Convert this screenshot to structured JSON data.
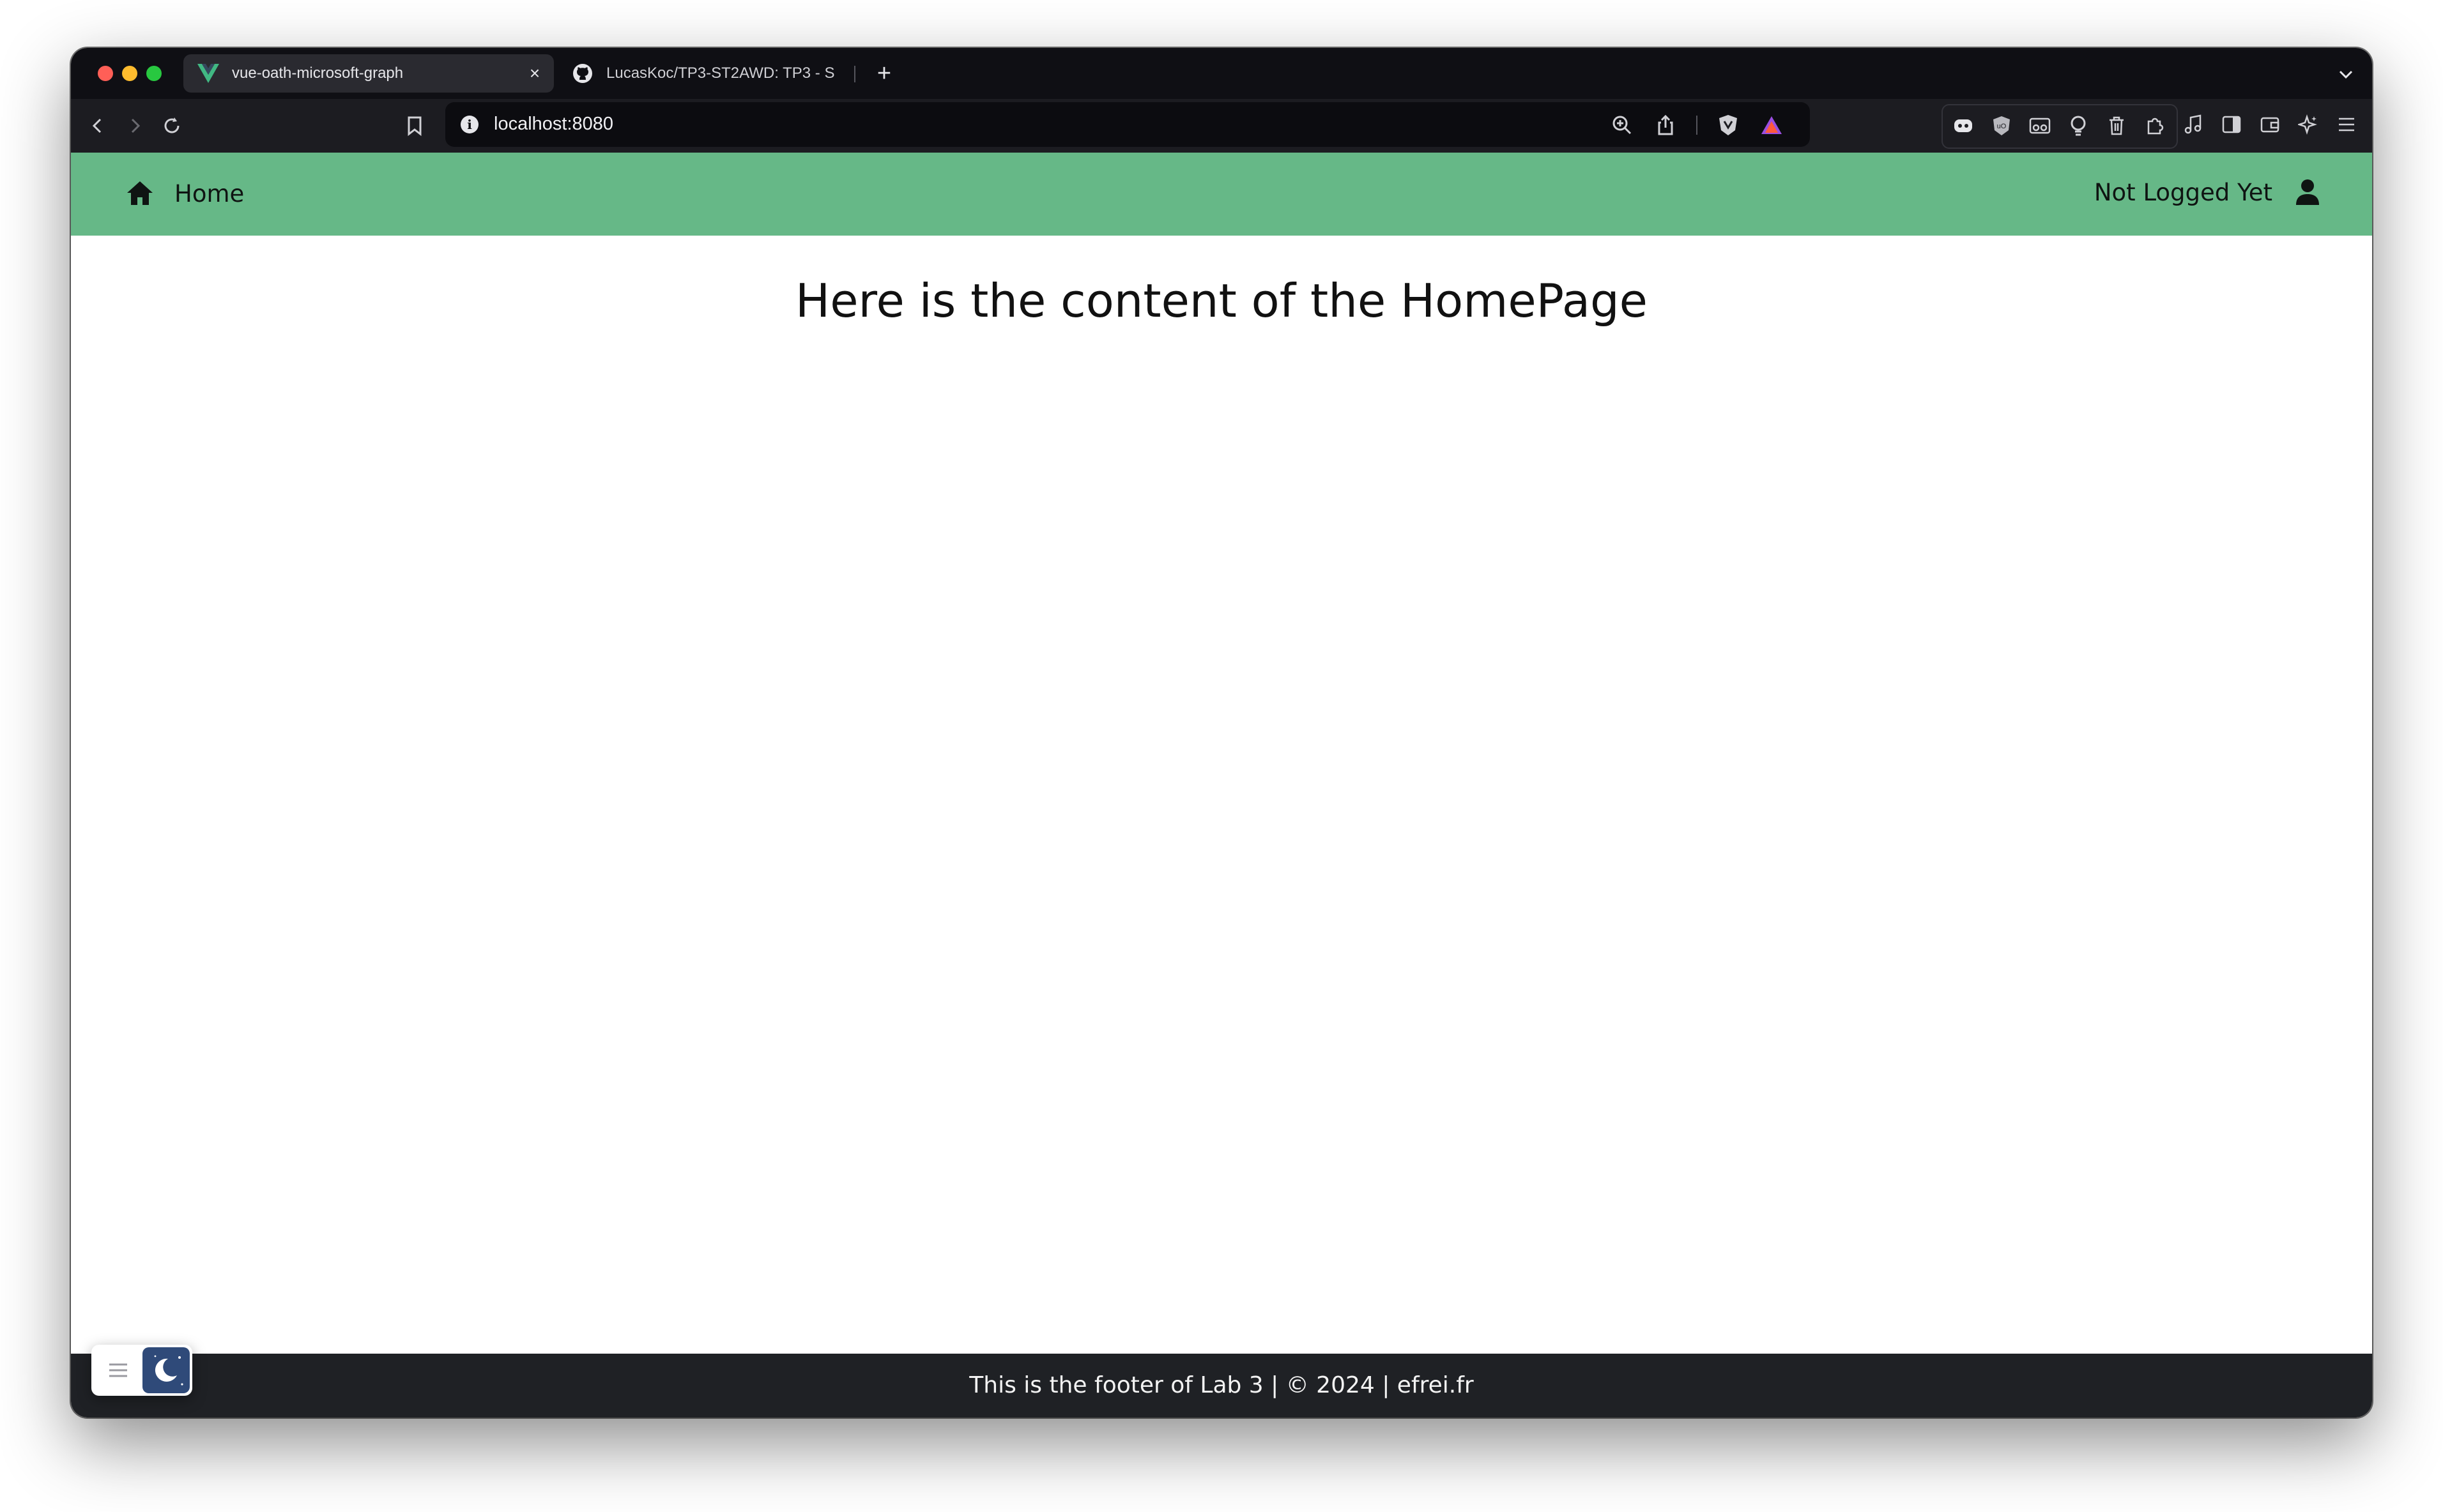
{
  "browser": {
    "tabs": [
      {
        "title": "vue-oath-microsoft-graph",
        "favicon": "vue-logo-icon",
        "active": true
      },
      {
        "title": "LucasKoc/TP3-ST2AWD: TP3 - S",
        "favicon": "github-icon",
        "active": false
      }
    ],
    "close_label": "×",
    "new_tab_label": "+",
    "address": "localhost:8080",
    "info_label": "i",
    "colors": {
      "tabbar": "#0f0f14",
      "toolbar": "#1c1c21",
      "urlbar": "#0c0c10"
    }
  },
  "navbar": {
    "home_label": "Home",
    "user_status": "Not Logged Yet",
    "color": "#66b887"
  },
  "main": {
    "heading": "Here is the content of the HomePage"
  },
  "footer": {
    "text": "This is the footer of Lab 3 | © 2024 | efrei.fr",
    "color": "#1f2125"
  },
  "widget": {
    "icons": [
      "menu-icon",
      "moon-icon"
    ],
    "accent": "#2f4a79"
  }
}
